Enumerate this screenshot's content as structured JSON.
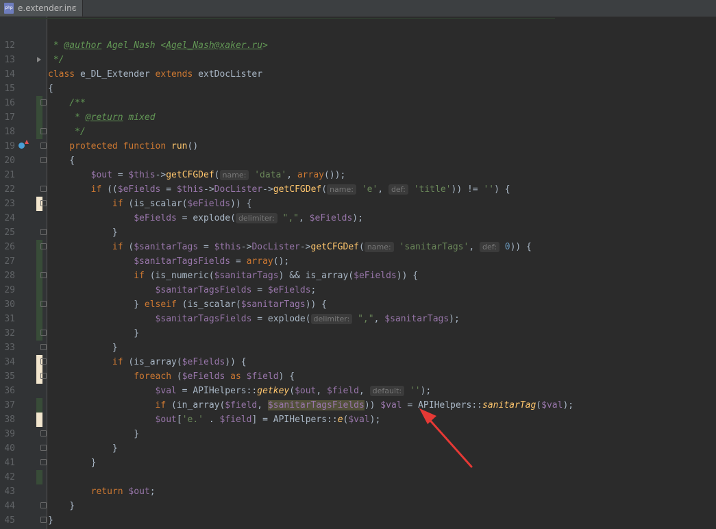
{
  "tab": {
    "filename": "e.extender.inc",
    "icon": "php-file-icon",
    "close": "×"
  },
  "colors": {
    "keyword": "#cc7832",
    "variable": "#9876aa",
    "string": "#6a8759",
    "function": "#ffc66d",
    "comment": "#629755",
    "number": "#6897bb",
    "text": "#a9b7c6"
  },
  "lines": [
    {
      "n": "12"
    },
    {
      "n": "13"
    },
    {
      "n": "14"
    },
    {
      "n": "15"
    },
    {
      "n": "16"
    },
    {
      "n": "17"
    },
    {
      "n": "18"
    },
    {
      "n": "19"
    },
    {
      "n": "20"
    },
    {
      "n": "21"
    },
    {
      "n": "22"
    },
    {
      "n": "23"
    },
    {
      "n": "24"
    },
    {
      "n": "25"
    },
    {
      "n": "26"
    },
    {
      "n": "27"
    },
    {
      "n": "28"
    },
    {
      "n": "29"
    },
    {
      "n": "30"
    },
    {
      "n": "31"
    },
    {
      "n": "32"
    },
    {
      "n": "33"
    },
    {
      "n": "34"
    },
    {
      "n": "35"
    },
    {
      "n": "36"
    },
    {
      "n": "37"
    },
    {
      "n": "38"
    },
    {
      "n": "39"
    },
    {
      "n": "40"
    },
    {
      "n": "41"
    },
    {
      "n": "42"
    },
    {
      "n": "43"
    },
    {
      "n": "44"
    },
    {
      "n": "45"
    }
  ],
  "code": {
    "l12_a": " * ",
    "l12_tag": "@author",
    "l12_b": " Agel_Nash <",
    "l12_email": "Agel_Nash@xaker.ru",
    "l12_c": ">",
    "l13": " */",
    "l14_kw": "class",
    "l14_a": " e_DL_Extender ",
    "l14_kw2": "extends",
    "l14_b": " extDocLister",
    "l15": "{",
    "l16": "    /**",
    "l17_a": "     * ",
    "l17_tag": "@return",
    "l17_b": " mixed",
    "l18": "     */",
    "l19_kw": "    protected function ",
    "l19_fn": "run",
    "l19_b": "()",
    "l20": "    {",
    "l21_ind": "        ",
    "l21_v": "$out",
    " l21_eq": "",
    "l21_eq": " = ",
    "l21_v2": "$this",
    "l21_ar": "->",
    "l21_fn": "getCFGDef",
    "l21_p": "(",
    "l21_h": "name:",
    "l21_s": "'data'",
    "l21_c": ", ",
    "l21_kw": "array",
    "l21_e": "());",
    "l22_ind": "        ",
    "l22_kw": "if",
    "l22_a": " ((",
    "l22_v": "$eFields",
    "l22_b": " = ",
    "l22_v2": "$this",
    "l22_ar": "->",
    "l22_prop": "DocLister",
    "l22_ar2": "->",
    "l22_fn": "getCFGDef",
    "l22_p": "(",
    "l22_h1": "name:",
    "l22_s1": "'e'",
    "l22_c": ", ",
    "l22_h2": "def:",
    "l22_s2": "'title'",
    "l22_d": ")) != ",
    "l22_s3": "''",
    "l22_e": ") {",
    "l23_ind": "            ",
    "l23_kw": "if",
    "l23_a": " (is_scalar(",
    "l23_v": "$eFields",
    "l23_e": ")) {",
    "l24_ind": "                ",
    "l24_v": "$eFields",
    "l24_a": " = explode(",
    "l24_h": "delimiter:",
    "l24_s": "\",\"",
    "l24_c": ", ",
    "l24_v2": "$eFields",
    "l24_e": ");",
    "l25": "            }",
    "l26_ind": "            ",
    "l26_kw": "if",
    "l26_a": " (",
    "l26_v": "$sanitarTags",
    "l26_b": " = ",
    "l26_v2": "$this",
    "l26_ar": "->",
    "l26_prop": "DocLister",
    "l26_ar2": "->",
    "l26_fn": "getCFGDef",
    "l26_p": "(",
    "l26_h1": "name:",
    "l26_s": "'sanitarTags'",
    "l26_c": ", ",
    "l26_h2": "def:",
    "l26_n": "0",
    "l26_e": ")) {",
    "l27_ind": "                ",
    "l27_v": "$sanitarTagsFields",
    "l27_a": " = ",
    "l27_kw": "array",
    "l27_e": "();",
    "l28_ind": "                ",
    "l28_kw": "if",
    "l28_a": " (is_numeric(",
    "l28_v": "$sanitarTags",
    "l28_b": ") && is_array(",
    "l28_v2": "$eFields",
    "l28_e": ")) {",
    "l29_ind": "                    ",
    "l29_v": "$sanitarTagsFields",
    "l29_a": " = ",
    "l29_v2": "$eFields",
    "l29_e": ";",
    "l30_ind": "                ",
    "l30_a": "} ",
    "l30_kw": "elseif",
    "l30_b": " (is_scalar(",
    "l30_v": "$sanitarTags",
    "l30_e": ")) {",
    "l31_ind": "                    ",
    "l31_v": "$sanitarTagsFields",
    "l31_a": " = explode(",
    "l31_h": "delimiter:",
    "l31_s": "\",\"",
    "l31_c": ", ",
    "l31_v2": "$sanitarTags",
    "l31_e": ");",
    "l32": "                }",
    "l33": "            }",
    "l34_ind": "            ",
    "l34_kw": "if",
    "l34_a": " (is_array(",
    "l34_v": "$eFields",
    "l34_e": ")) {",
    "l35_ind": "                ",
    "l35_kw": "foreach",
    "l35_a": " (",
    "l35_v": "$eFields",
    "l35_kw2": " as ",
    "l35_v2": "$field",
    "l35_e": ") {",
    "l36_ind": "                    ",
    "l36_v": "$val",
    "l36_a": " = APIHelpers::",
    "l36_fn": "getkey",
    "l36_b": "(",
    "l36_v2": "$out",
    "l36_c": ", ",
    "l36_v3": "$field",
    "l36_c2": ", ",
    "l36_h": "default:",
    "l36_s": "''",
    "l36_e": ");",
    "l37_ind": "                    ",
    "l37_kw": "if",
    "l37_a": " (in_array(",
    "l37_v": "$field",
    "l37_c": ", ",
    "l37_v2": "$sanitarTagsFields",
    "l37_b": ")) ",
    "l37_v3": "$val",
    "l37_d": " = APIHelpers::",
    "l37_fn": "sanitarTag",
    "l37_p": "(",
    "l37_v4": "$val",
    "l37_e": ");",
    "l38_ind": "                    ",
    "l38_v": "$out",
    "l38_a": "[",
    "l38_s": "'e.'",
    "l38_b": " . ",
    "l38_v2": "$field",
    "l38_c": "] = APIHelpers::",
    "l38_fn": "e",
    "l38_p": "(",
    "l38_v3": "$val",
    "l38_e": ");",
    "l39": "                }",
    "l40": "            }",
    "l41": "        }",
    "l42": "",
    "l43_ind": "        ",
    "l43_kw": "return",
    "l43_a": " ",
    "l43_v": "$out",
    "l43_e": ";",
    "l44": "    }",
    "l45": "}"
  }
}
